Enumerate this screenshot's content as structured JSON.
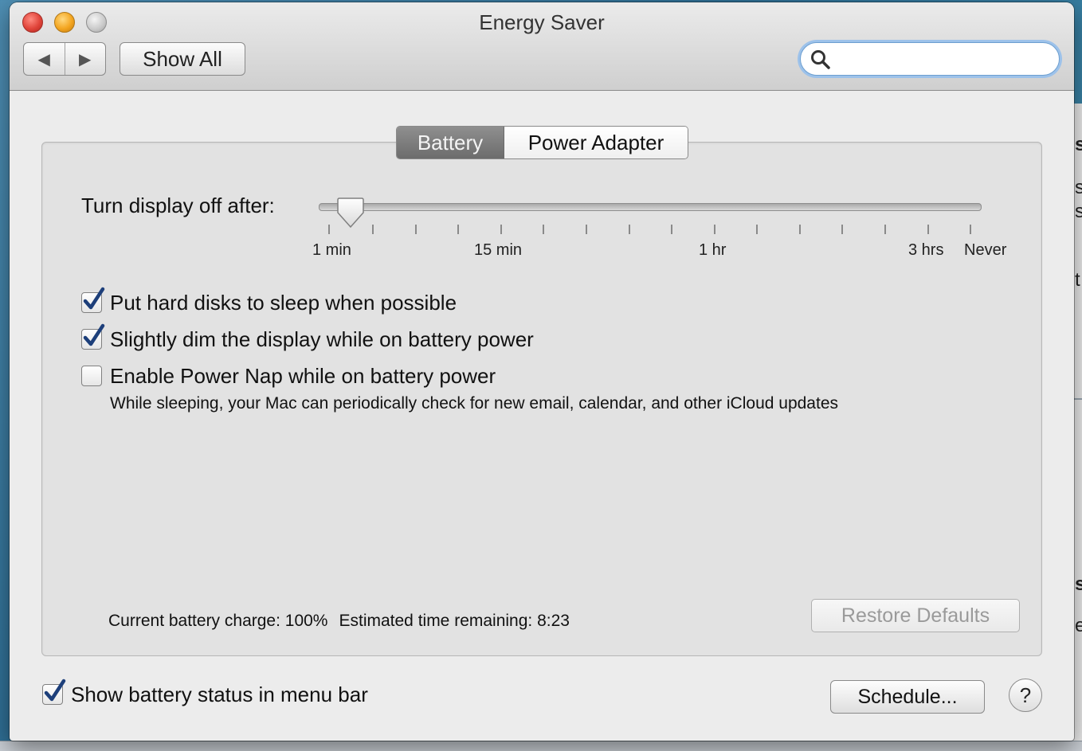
{
  "window": {
    "title": "Energy Saver",
    "nav": {
      "back_glyph": "◀",
      "forward_glyph": "▶"
    },
    "show_all_label": "Show All",
    "search": {
      "placeholder": "",
      "value": "",
      "icon": "magnifying-glass-icon"
    }
  },
  "tabs": [
    {
      "label": "Battery",
      "selected": true
    },
    {
      "label": "Power Adapter",
      "selected": false
    }
  ],
  "display_sleep": {
    "label": "Turn display off after:",
    "value": "1 min",
    "tick_labels": [
      "1 min",
      "15 min",
      "1 hr",
      "3 hrs",
      "Never"
    ]
  },
  "options": [
    {
      "label": "Put hard disks to sleep when possible",
      "checked": true
    },
    {
      "label": "Slightly dim the display while on battery power",
      "checked": true
    },
    {
      "label": "Enable Power Nap while on battery power",
      "checked": false,
      "description": "While sleeping, your Mac can periodically check for new email, calendar, and other iCloud updates"
    }
  ],
  "status": {
    "charge": "Current battery charge: 100%",
    "remaining": "Estimated time remaining: 8:23"
  },
  "buttons": {
    "restore_defaults": "Restore Defaults",
    "schedule": "Schedule...",
    "help": "?"
  },
  "footer": {
    "show_status_label": "Show battery status in menu bar",
    "show_status_checked": true
  },
  "background_window": {
    "fragments": [
      "s",
      "s",
      "s",
      "t",
      "s",
      "e"
    ]
  },
  "colors": {
    "accent": "#2a6bd1",
    "checkmark": "#1d3f7a",
    "tab_selected": "#7b7b7b"
  }
}
